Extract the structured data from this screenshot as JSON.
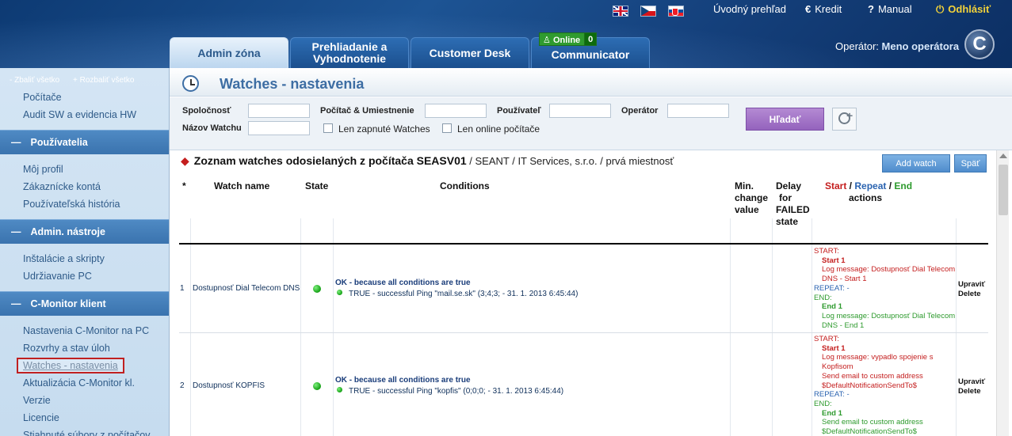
{
  "header": {
    "links": {
      "overview": "Úvodný prehľad",
      "credit": "Kredit",
      "manual": "Manual",
      "logout": "Odhlásiť"
    },
    "icons": {
      "credit": "euro-icon",
      "manual": "question-icon",
      "logout": "power-icon"
    },
    "tabs": {
      "admin": "Admin zóna",
      "review_1": "Prehliadanie a",
      "review_2": "Vyhodnotenie",
      "desk": "Customer Desk",
      "communicator": "Communicator"
    },
    "online": {
      "label": "Online",
      "count": "0"
    },
    "operator": {
      "label": "Operátor:",
      "name": "Meno operátora"
    },
    "logo": "C"
  },
  "sidebar": {
    "collapse_all": "- Zbaliť všetko",
    "expand_all": "+ Rozbaliť všetko",
    "top_items": [
      "Počítače",
      "Audit SW a evidencia HW"
    ],
    "sections": [
      {
        "title": "Používatelia",
        "items": [
          "Môj profil",
          "Zákaznícke kontá",
          "Používateľská história"
        ]
      },
      {
        "title": "Admin. nástroje",
        "items": [
          "Inštalácie a skripty",
          "Udržiavanie PC"
        ]
      },
      {
        "title": "C-Monitor klient",
        "items": [
          "Nastavenia C-Monitor na PC",
          "Rozvrhy a stav úloh",
          "Watches - nastavenia",
          "Aktualizácia C-Monitor kl.",
          "Verzie",
          "Licencie",
          "Stiahnuté súbory z počítačov"
        ]
      }
    ]
  },
  "page": {
    "title": "Watches - nastavenia",
    "filters": {
      "company": "Spoločnosť",
      "computer": "Počítač & Umiestnenie",
      "user": "Používateľ",
      "operator": "Operátor",
      "watch_name": "Názov Watchu",
      "only_enabled": "Len zapnuté Watches",
      "only_online": "Len online počítače",
      "search": "Hľadať"
    },
    "list": {
      "heading": "Zoznam watches odosielaných z počítača SEASV01",
      "context": " / SEANT / IT Services, s.r.o. / prvá miestnosť",
      "add_watch": "Add watch",
      "back": "Späť"
    },
    "columns": {
      "star": "*",
      "name": "Watch name",
      "state": "State",
      "conditions": "Conditions",
      "min_change": [
        "Min.",
        "change",
        "value"
      ],
      "delay": [
        "Delay",
        "for",
        "FAILED",
        "state"
      ],
      "actions_start": "Start",
      "actions_repeat": "Repeat",
      "actions_end": "End",
      "actions_sep": " / ",
      "actions_word": "actions"
    },
    "rows": [
      {
        "num": "1",
        "name": "Dostupnosť Dial Telecom DNS",
        "cond_main": "OK - because all conditions are true",
        "cond_sub": "TRUE - successful Ping \"mail.se.sk\" (3;4;3; - 31. 1. 2013 6:45:44)",
        "start_lbl": "START:",
        "start_num": "Start 1",
        "start_lines": [
          "Log message: Dostupnosť Dial Telecom",
          "DNS - Start 1"
        ],
        "repeat_lbl": "REPEAT: -",
        "end_lbl": "END:",
        "end_num": "End 1",
        "end_lines": [
          "Log message: Dostupnosť Dial Telecom",
          "DNS - End 1"
        ],
        "edit": "Upraviť",
        "delete": "Delete"
      },
      {
        "num": "2",
        "name": "Dostupnosť KOPFIS",
        "cond_main": "OK - because all conditions are true",
        "cond_sub": "TRUE - successful Ping \"kopfis\" (0;0;0; - 31. 1. 2013 6:45:44)",
        "start_lbl": "START:",
        "start_num": "Start 1",
        "start_lines": [
          "Log message: vypadlo spojenie s",
          "Kopfisom",
          "Send email to custom address",
          "$DefaultNotificationSendTo$"
        ],
        "repeat_lbl": "REPEAT: -",
        "end_lbl": "END:",
        "end_num": "End 1",
        "end_lines": [
          "Send email to custom address",
          "$DefaultNotificationSendTo$"
        ],
        "edit": "Upraviť",
        "delete": "Delete"
      }
    ]
  },
  "colors": {
    "header_blue": "#1d5494",
    "sidebar_section": "#4f8ac4",
    "search_button": "#9463bd",
    "start": "#c41e1e",
    "repeat": "#2a63b0",
    "end": "#2d9a2d",
    "status_ok": "#14a014"
  }
}
